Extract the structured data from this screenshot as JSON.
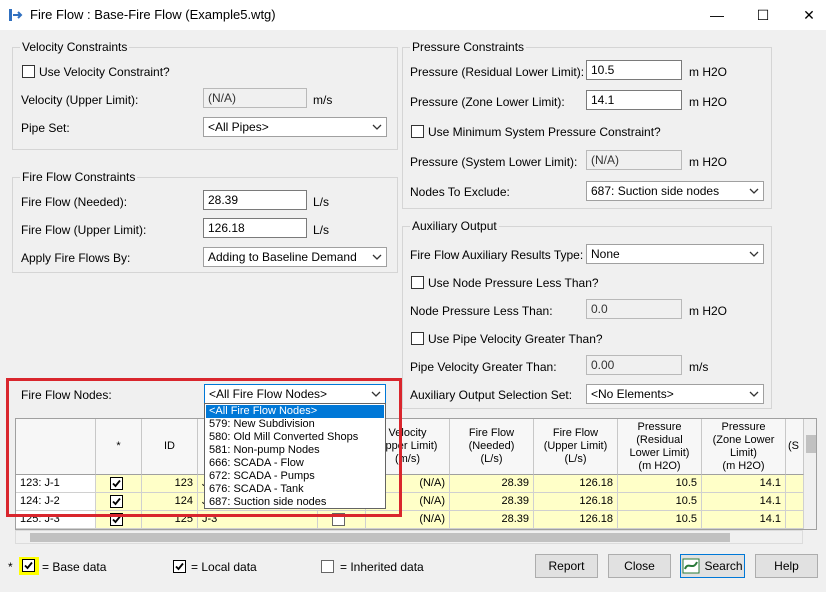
{
  "window": {
    "title": "Fire Flow : Base-Fire Flow (Example5.wtg)",
    "min": "—",
    "max": "☐",
    "close": "✕"
  },
  "velocity": {
    "group": "Velocity Constraints",
    "use_label": "Use Velocity Constraint?",
    "upper_label": "Velocity (Upper Limit):",
    "upper_value": "(N/A)",
    "upper_unit": "m/s",
    "pipe_set_label": "Pipe Set:",
    "pipe_set_value": "<All Pipes>"
  },
  "fireflow": {
    "group": "Fire Flow Constraints",
    "needed_label": "Fire Flow (Needed):",
    "needed_value": "28.39",
    "needed_unit": "L/s",
    "upper_label": "Fire Flow (Upper Limit):",
    "upper_value": "126.18",
    "upper_unit": "L/s",
    "apply_label": "Apply Fire Flows By:",
    "apply_value": "Adding to Baseline Demand"
  },
  "pressure": {
    "group": "Pressure Constraints",
    "residual_label": "Pressure (Residual Lower Limit):",
    "residual_value": "10.5",
    "residual_unit": "m H2O",
    "zone_label": "Pressure (Zone Lower Limit):",
    "zone_value": "14.1",
    "zone_unit": "m H2O",
    "use_min_label": "Use Minimum System Pressure Constraint?",
    "system_label": "Pressure (System Lower Limit):",
    "system_value": "(N/A)",
    "system_unit": "m H2O",
    "exclude_label": "Nodes To Exclude:",
    "exclude_value": "687: Suction side nodes"
  },
  "aux": {
    "group": "Auxiliary Output",
    "type_label": "Fire Flow Auxiliary Results Type:",
    "type_value": "None",
    "use_node_label": "Use Node Pressure Less Than?",
    "node_label": "Node Pressure Less Than:",
    "node_value": "0.0",
    "node_unit": "m H2O",
    "use_pipe_label": "Use Pipe Velocity Greater Than?",
    "pipe_label": "Pipe Velocity Greater Than:",
    "pipe_value": "0.00",
    "pipe_unit": "m/s",
    "sel_label": "Auxiliary Output Selection Set:",
    "sel_value": "<No Elements>"
  },
  "nodes": {
    "label": "Fire Flow Nodes:",
    "value": "<All Fire Flow Nodes>",
    "options": [
      "<All Fire Flow Nodes>",
      "579: New Subdivision",
      "580: Old Mill Converted Shops",
      "581: Non-pump Nodes",
      "666: SCADA - Flow",
      "672: SCADA - Pumps",
      "676: SCADA - Tank",
      "687: Suction side nodes"
    ]
  },
  "grid": {
    "headers": [
      "*",
      "ID",
      "Velocity (Upper Limit) (m/s)",
      "Fire Flow (Needed) (L/s)",
      "Fire Flow (Upper Limit) (L/s)",
      "Pressure (Residual Lower Limit) (m H2O)",
      "Pressure (Zone Lower Limit) (m H2O)",
      "(S"
    ],
    "h_vel": [
      "Velocity",
      "Upper Limit)",
      "(m/s)"
    ],
    "h_ffn": [
      "Fire Flow",
      "(Needed)",
      "(L/s)"
    ],
    "h_ffu": [
      "Fire Flow",
      "(Upper Limit)",
      "(L/s)"
    ],
    "h_pr": [
      "Pressure",
      "(Residual",
      "Lower Limit)",
      "(m H2O)"
    ],
    "h_pz": [
      "Pressure",
      "(Zone Lower",
      "Limit)",
      "(m H2O)"
    ],
    "rows": [
      {
        "name": "123: J-1",
        "id": "123",
        "label": "J-",
        "vel": "(N/A)",
        "needed": "28.39",
        "upper": "126.18",
        "residual": "10.5",
        "zone": "14.1"
      },
      {
        "name": "124: J-2",
        "id": "124",
        "label": "J-",
        "vel": "(N/A)",
        "needed": "28.39",
        "upper": "126.18",
        "residual": "10.5",
        "zone": "14.1"
      },
      {
        "name": "125: J-3",
        "id": "125",
        "label": "J-3",
        "vel": "(N/A)",
        "needed": "28.39",
        "upper": "126.18",
        "residual": "10.5",
        "zone": "14.1"
      }
    ]
  },
  "legend": {
    "star": "*",
    "base": "= Base data",
    "local": "= Local data",
    "inherited": "= Inherited data"
  },
  "buttons": {
    "report": "Report",
    "close": "Close",
    "search": "Search",
    "help": "Help"
  },
  "colors": {
    "highlight": "#d9262d",
    "selected": "#0078d7",
    "base_fill": "#ffff00"
  }
}
